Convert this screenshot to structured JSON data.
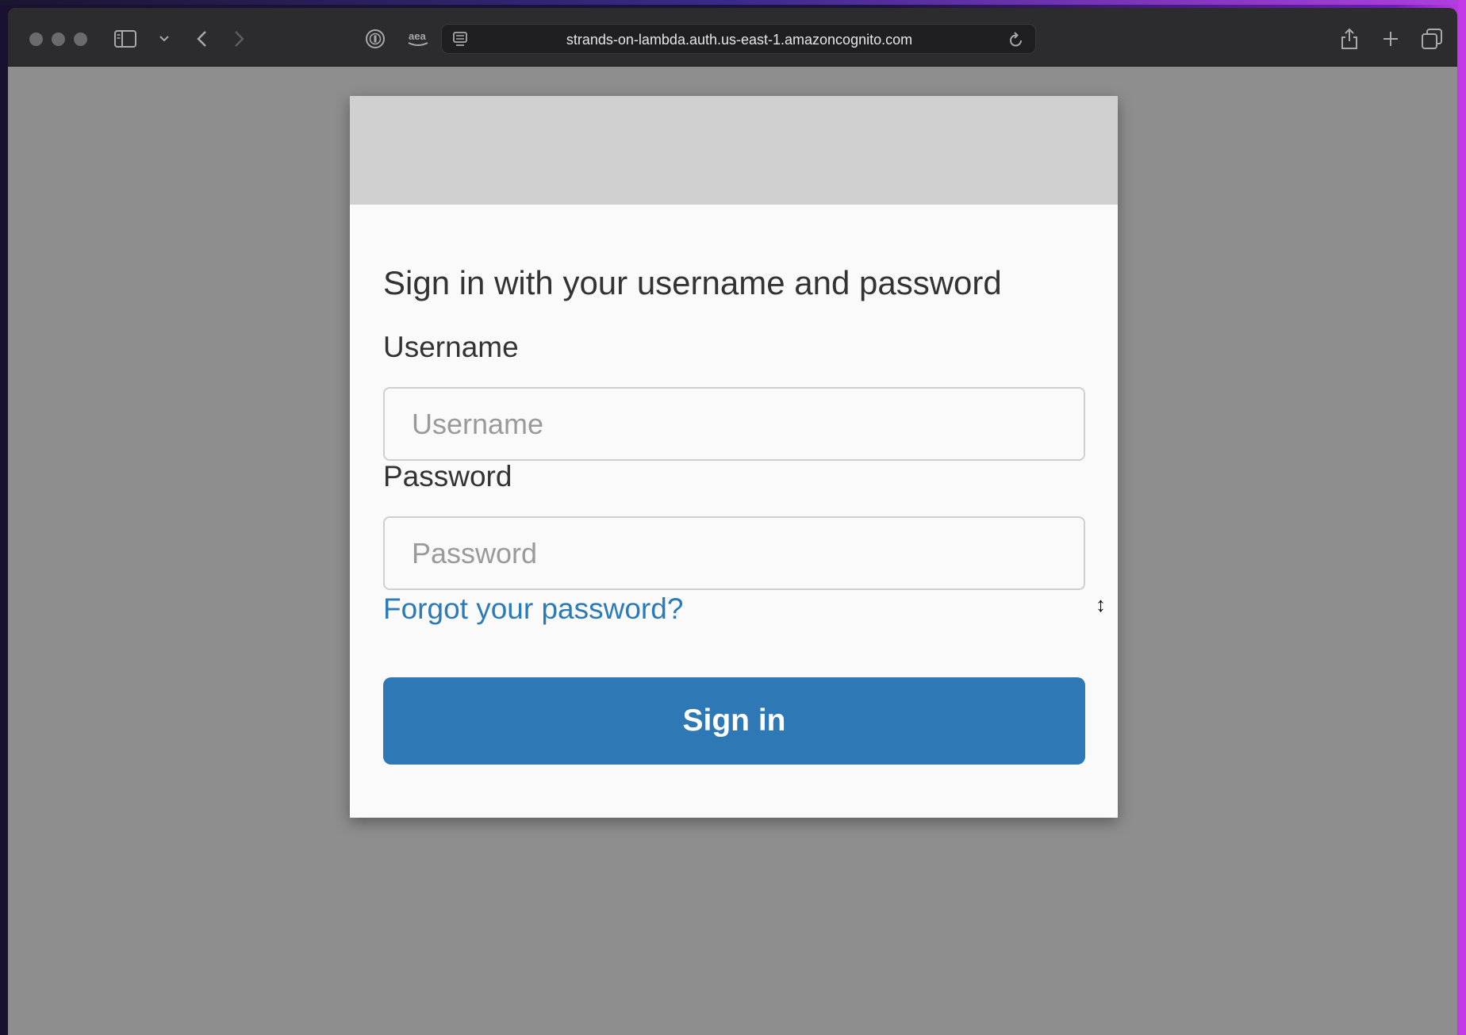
{
  "browser": {
    "url": "strands-on-lambda.auth.us-east-1.amazoncognito.com"
  },
  "colors": {
    "accent": "#2e79b5",
    "link": "#2b7bb9",
    "page_bg": "#8e8e8e",
    "banner": "#d0d0d0"
  },
  "login": {
    "heading": "Sign in with your username and password",
    "username_label": "Username",
    "username_placeholder": "Username",
    "password_label": "Password",
    "password_placeholder": "Password",
    "forgot_link": "Forgot your password?",
    "submit_label": "Sign in"
  },
  "icons": [
    "traffic-light-close",
    "traffic-light-minimize",
    "traffic-light-zoom",
    "sidebar-icon",
    "chevron-down-icon",
    "back-icon",
    "forward-icon",
    "password-manager-icon",
    "amazon-extension-icon",
    "page-menu-icon",
    "reload-icon",
    "share-icon",
    "new-tab-icon",
    "tabs-overview-icon",
    "resize-cursor-icon"
  ]
}
